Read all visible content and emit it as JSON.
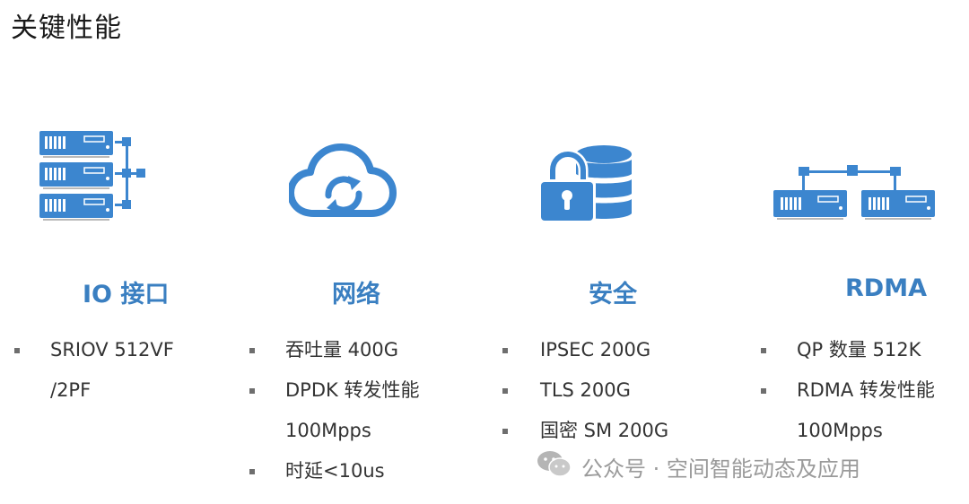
{
  "page_title": "关键性能",
  "columns": [
    {
      "title": "IO 接口",
      "icon": "server-stack-icon",
      "bullets": [
        "SRIOV 512VF",
        "/2PF"
      ]
    },
    {
      "title": "网络",
      "icon": "cloud-sync-icon",
      "bullets": [
        "吞吐量 400G",
        "DPDK 转发性能",
        "100Mpps",
        "时延<10us"
      ]
    },
    {
      "title": "安全",
      "icon": "lock-database-icon",
      "bullets": [
        "IPSEC 200G",
        "TLS 200G",
        "国密 SM 200G"
      ]
    },
    {
      "title": "RDMA",
      "icon": "network-servers-icon",
      "bullets": [
        "QP 数量 512K",
        "RDMA 转发性能",
        "100Mpps"
      ]
    }
  ],
  "watermark": {
    "text": "公众号 · 空间智能动态及应用",
    "icon": "wechat-icon"
  },
  "colors": {
    "accent": "#3a7fc1",
    "icon_blue": "#3c86cf",
    "text": "#333333",
    "bullet": "#6e6e6e",
    "watermark": "#9a9a9a"
  }
}
